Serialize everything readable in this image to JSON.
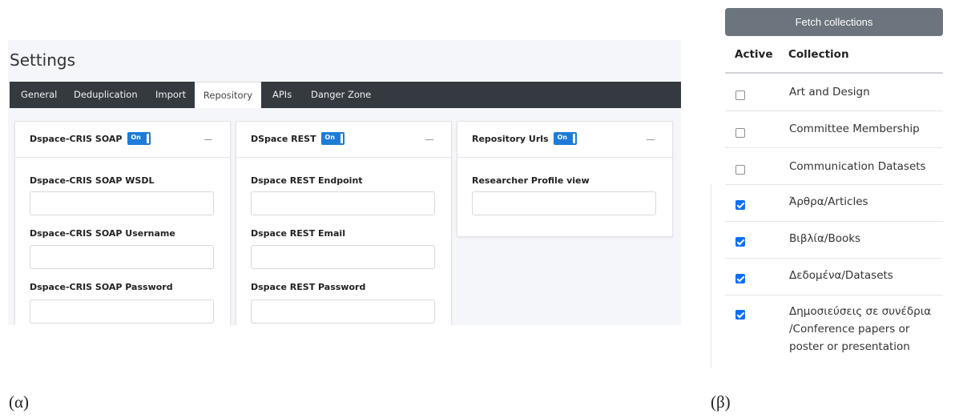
{
  "settings": {
    "title": "Settings",
    "tabs": [
      {
        "label": "General",
        "active": false
      },
      {
        "label": "Deduplication",
        "active": false
      },
      {
        "label": "Import",
        "active": false
      },
      {
        "label": "Repository",
        "active": true
      },
      {
        "label": "APIs",
        "active": false
      },
      {
        "label": "Danger Zone",
        "active": false
      }
    ],
    "toggle_label": "On",
    "cards": [
      {
        "title": "Dspace-CRIS SOAP",
        "enabled": true,
        "fields": [
          {
            "label": "Dspace-CRIS SOAP WSDL",
            "value": ""
          },
          {
            "label": "Dspace-CRIS SOAP Username",
            "value": ""
          },
          {
            "label": "Dspace-CRIS SOAP Password",
            "value": ""
          }
        ]
      },
      {
        "title": "DSpace REST",
        "enabled": true,
        "fields": [
          {
            "label": "Dspace REST Endpoint",
            "value": ""
          },
          {
            "label": "Dspace REST Email",
            "value": ""
          },
          {
            "label": "Dspace REST Password",
            "value": ""
          }
        ]
      },
      {
        "title": "Repository Urls",
        "enabled": true,
        "fields": [
          {
            "label": "Researcher Profile view",
            "value": ""
          }
        ]
      }
    ]
  },
  "collections": {
    "fetch_button": "Fetch collections",
    "headers": {
      "active": "Active",
      "collection": "Collection"
    },
    "rows": [
      {
        "name": "Art and Design",
        "active": false
      },
      {
        "name": "Committee Membership",
        "active": false
      },
      {
        "name": "Communication Datasets",
        "active": false
      },
      {
        "name": "Άρθρα/Articles",
        "active": true
      },
      {
        "name": "Βιβλία/Books",
        "active": true
      },
      {
        "name": "Δεδομένα/Datasets",
        "active": true
      },
      {
        "name": "Δημοσιεύσεις σε συνέδρια /Conference papers or poster or presentation",
        "active": true
      }
    ]
  },
  "captions": {
    "left": "(α)",
    "right": "(β)"
  },
  "colors": {
    "tabbar": "#343a40",
    "toggle": "#1e7bd8",
    "fetch_button": "#6c757d",
    "checkbox_checked": "#0d6efd"
  }
}
